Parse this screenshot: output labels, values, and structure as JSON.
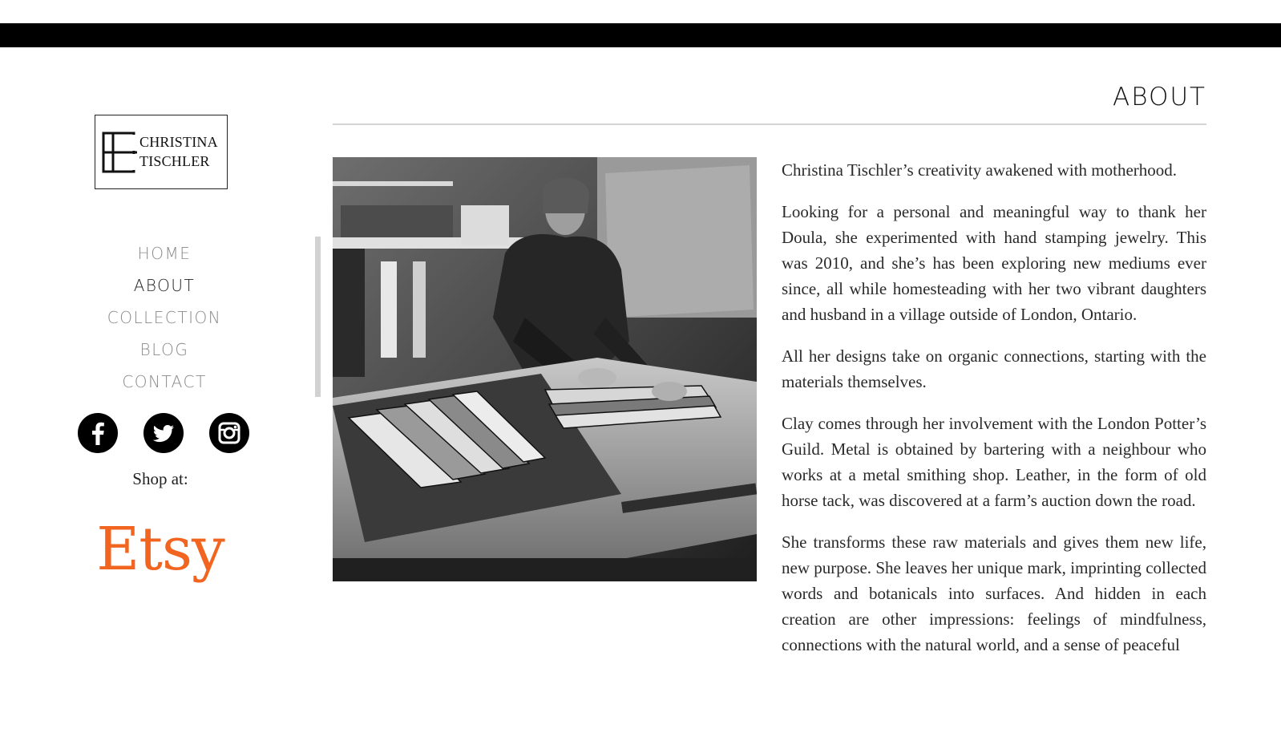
{
  "logo": {
    "line1": "CHRISTINA",
    "line2": "TISCHLER"
  },
  "nav": {
    "items": [
      {
        "label": "HOME"
      },
      {
        "label": "ABOUT"
      },
      {
        "label": "COLLECTION"
      },
      {
        "label": "BLOG"
      },
      {
        "label": "CONTACT"
      }
    ],
    "active": "ABOUT"
  },
  "social": {
    "icons": [
      "facebook-icon",
      "twitter-icon",
      "instagram-icon"
    ]
  },
  "shop": {
    "label": "Shop at:",
    "etsy": "Etsy"
  },
  "page": {
    "title": "ABOUT"
  },
  "photo": {
    "description_icon": "woodworking-photo"
  },
  "article": {
    "paragraphs": [
      "Christina Tischler’s creativity awakened with motherhood.",
      "Looking for a personal and meaningful way to thank her Doula, she experimented with hand stamping jewelry. This was 2010, and she’s has been exploring new mediums ever since, all while homesteading with her two vibrant daughters and husband in a village outside of London, Ontario.",
      "All her designs take on organic connections, starting with the materials themselves.",
      "Clay comes through her involvement with the London Potter’s Guild. Metal is obtained by bartering with a neighbour who works at a metal smithing shop. Leather, in the form of old horse tack, was discovered at a farm’s auction down the road.",
      "She transforms these raw materials and gives them new life, new purpose. She leaves her unique mark, imprinting collected words and botanicals into surfaces. And hidden in each creation are other impressions: feelings of mindfulness, connections with the natural world, and a sense of peaceful"
    ]
  },
  "colors": {
    "topbar": "#000000",
    "etsy": "#f16521",
    "nav_inactive": "#8a8a8a",
    "rule": "#d4d4d4"
  }
}
